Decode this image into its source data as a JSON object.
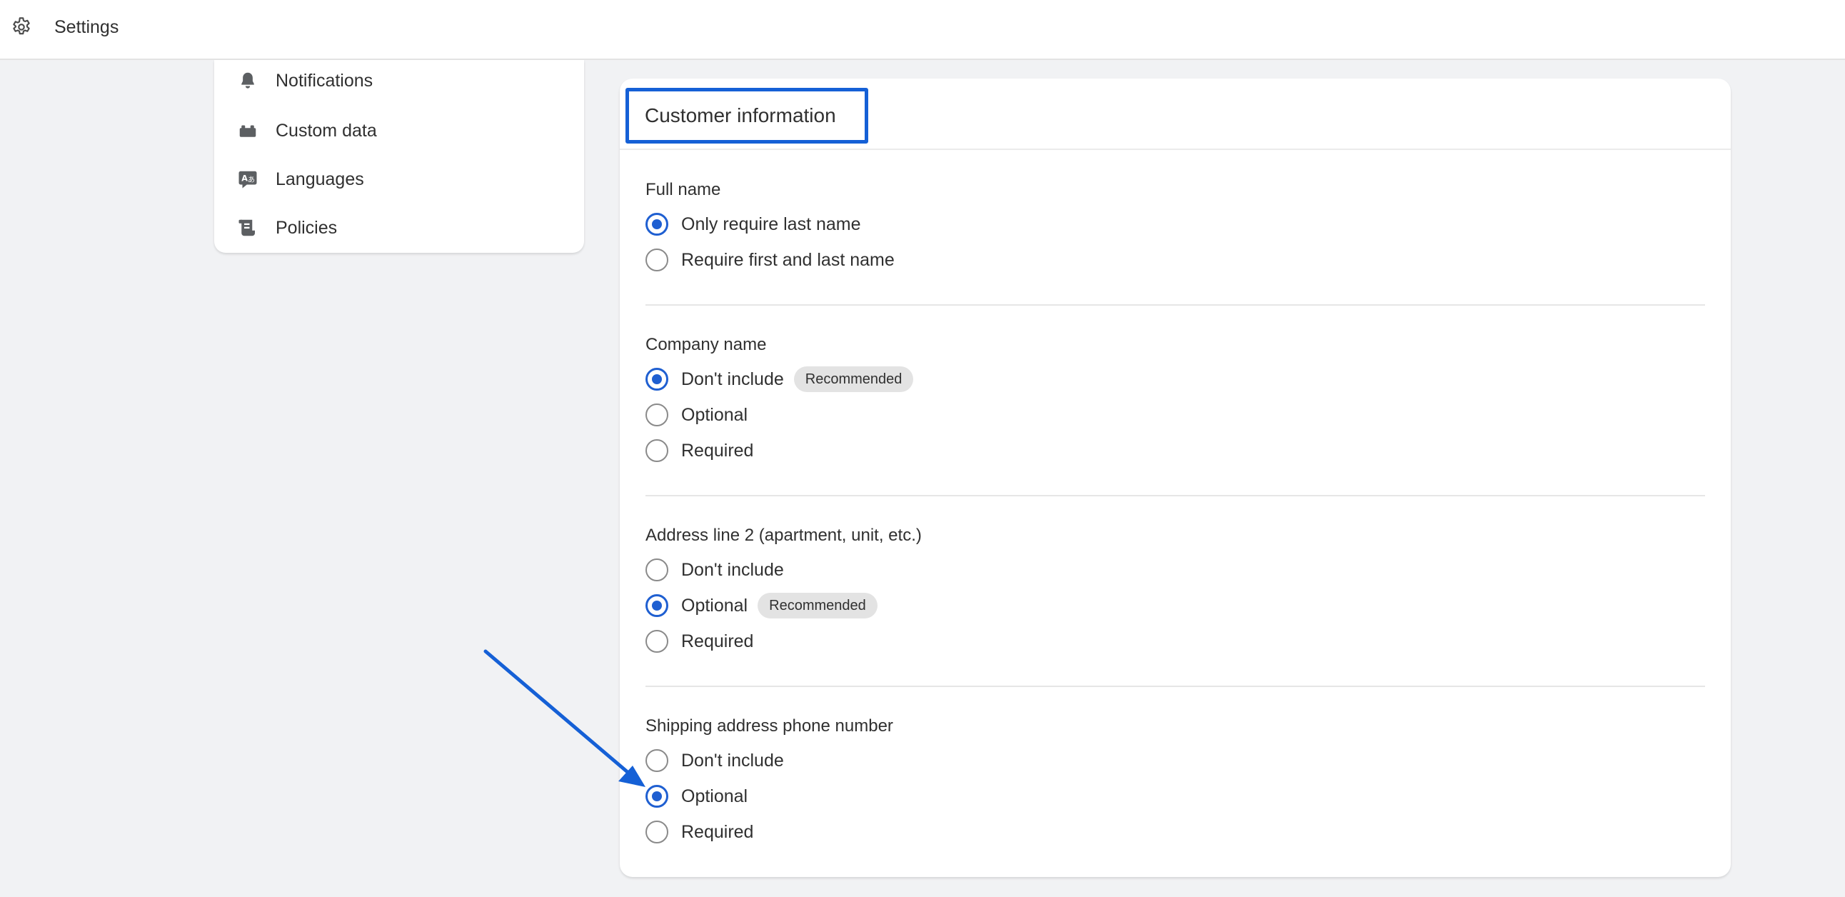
{
  "topbar": {
    "title": "Settings",
    "icon": "gear-icon"
  },
  "sidebar": {
    "items": [
      {
        "label": "Notifications",
        "icon": "bell-icon"
      },
      {
        "label": "Custom data",
        "icon": "custom-data-icon"
      },
      {
        "label": "Languages",
        "icon": "languages-icon"
      },
      {
        "label": "Policies",
        "icon": "policies-icon"
      }
    ]
  },
  "card": {
    "title": "Customer information",
    "highlight_color": "#1560d6",
    "sections": [
      {
        "heading": "Full name",
        "options": [
          {
            "label": "Only require last name",
            "checked": true
          },
          {
            "label": "Require first and last name",
            "checked": false
          }
        ]
      },
      {
        "heading": "Company name",
        "options": [
          {
            "label": "Don't include",
            "checked": true,
            "badge": "Recommended"
          },
          {
            "label": "Optional",
            "checked": false
          },
          {
            "label": "Required",
            "checked": false
          }
        ]
      },
      {
        "heading": "Address line 2 (apartment, unit, etc.)",
        "options": [
          {
            "label": "Don't include",
            "checked": false
          },
          {
            "label": "Optional",
            "checked": true,
            "badge": "Recommended"
          },
          {
            "label": "Required",
            "checked": false
          }
        ]
      },
      {
        "heading": "Shipping address phone number",
        "options": [
          {
            "label": "Don't include",
            "checked": false
          },
          {
            "label": "Optional",
            "checked": true
          },
          {
            "label": "Required",
            "checked": false
          }
        ]
      }
    ]
  },
  "annotation": {
    "arrow_color": "#1560d6",
    "points_to": "Shipping address phone number: Optional"
  }
}
